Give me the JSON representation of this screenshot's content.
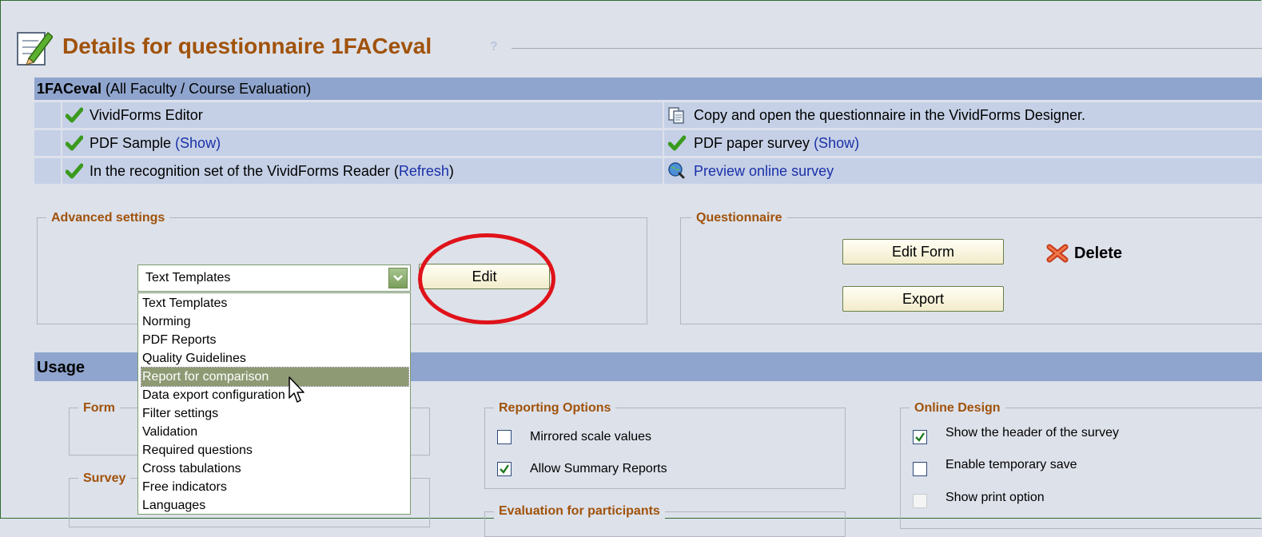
{
  "header": {
    "title": "Details for questionnaire 1FACeval",
    "help": "?"
  },
  "info": {
    "name": "1FACeval",
    "scope": " (All Faculty / Course Evaluation)",
    "rows": [
      {
        "left": "VividForms Editor",
        "right": "Copy and open the questionnaire in the VividForms Designer."
      },
      {
        "left": "PDF Sample ",
        "left_link": "(Show)",
        "right": "PDF paper survey ",
        "right_link": "(Show)"
      },
      {
        "left": "In the recognition set of the VividForms Reader (",
        "left_link": "Refresh",
        "left_end": ")",
        "right_link": "Preview online survey"
      }
    ]
  },
  "advanced": {
    "legend": "Advanced settings",
    "select_value": "Text Templates",
    "edit_label": "Edit",
    "options": [
      "Text Templates",
      "Norming",
      "PDF Reports",
      "Quality Guidelines",
      "Report for comparison",
      "Data export configuration",
      "Filter settings",
      "Validation",
      "Required questions",
      "Cross tabulations",
      "Free indicators",
      "Languages"
    ],
    "selected_option": "Report for comparison"
  },
  "questionnaire": {
    "legend": "Questionnaire",
    "edit_form_label": "Edit Form",
    "export_label": "Export",
    "delete_label": "Delete"
  },
  "usage": {
    "title": "Usage",
    "form_legend": "Form",
    "survey_legend": "Survey",
    "reporting": {
      "legend": "Reporting Options",
      "items": [
        {
          "label": "Mirrored scale values",
          "checked": false
        },
        {
          "label": "Allow Summary Reports",
          "checked": true
        }
      ]
    },
    "evaluation_legend": "Evaluation for participants",
    "online": {
      "legend": "Online Design",
      "items": [
        {
          "label": "Show the header of the survey",
          "checked": true
        },
        {
          "label": "Enable temporary save",
          "checked": false
        },
        {
          "label": "Show print option",
          "checked": false,
          "disabled": true
        }
      ]
    }
  },
  "colors": {
    "accent": "#a0520a",
    "header_bar": "#8fa5ce",
    "row_bg": "#c5d0e6",
    "link": "#1a30a8",
    "highlight": "#e0121a"
  }
}
